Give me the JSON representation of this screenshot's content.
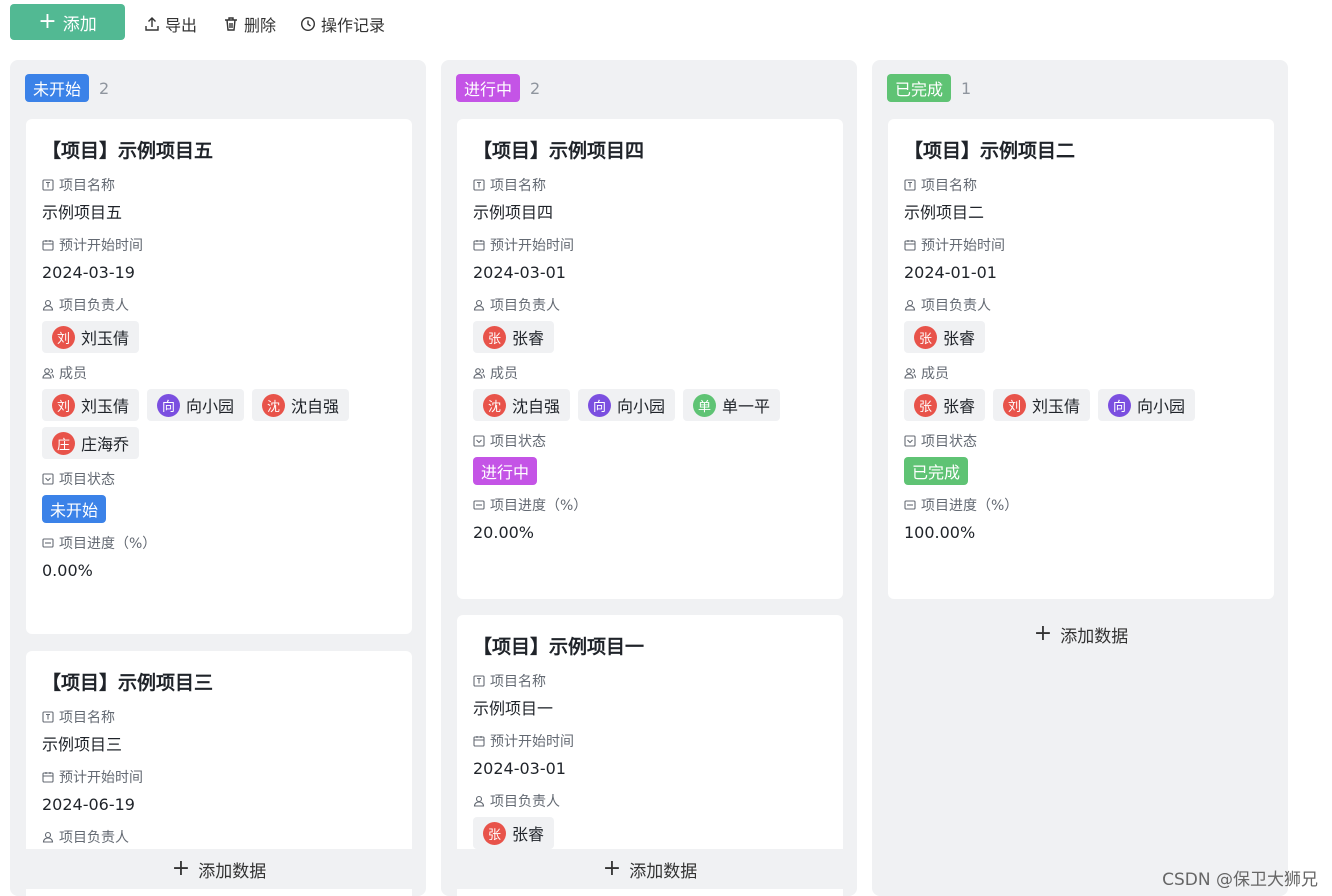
{
  "toolbar": {
    "add_label": "添加",
    "export_label": "导出",
    "delete_label": "删除",
    "history_label": "操作记录"
  },
  "field_labels": {
    "name": "项目名称",
    "start": "预计开始时间",
    "owner": "项目负责人",
    "members": "成员",
    "status": "项目状态",
    "progress": "项目进度（%）"
  },
  "add_data_label": "添加数据",
  "colors": {
    "not_started": "#3b82e8",
    "in_progress": "#c454e6",
    "done": "#5fc374",
    "add_button": "#52b993"
  },
  "columns": [
    {
      "status": "未开始",
      "count": "2",
      "cards": [
        {
          "title": "【项目】示例项目五",
          "name": "示例项目五",
          "start": "2024-03-19",
          "owner": [
            {
              "name": "刘玉倩",
              "initial": "刘",
              "color": "#e8534a"
            }
          ],
          "members": [
            {
              "name": "刘玉倩",
              "initial": "刘",
              "color": "#e8534a"
            },
            {
              "name": "向小园",
              "initial": "向",
              "color": "#7b4fe0"
            },
            {
              "name": "沈自强",
              "initial": "沈",
              "color": "#e8534a"
            },
            {
              "name": "庄海乔",
              "initial": "庄",
              "color": "#e8534a"
            }
          ],
          "status": "未开始",
          "progress": "0.00%"
        },
        {
          "title": "【项目】示例项目三",
          "name": "示例项目三",
          "start": "2024-06-19",
          "owner_partial": "项目负责人"
        }
      ]
    },
    {
      "status": "进行中",
      "count": "2",
      "cards": [
        {
          "title": "【项目】示例项目四",
          "name": "示例项目四",
          "start": "2024-03-01",
          "owner": [
            {
              "name": "张睿",
              "initial": "张",
              "color": "#e8534a"
            }
          ],
          "members": [
            {
              "name": "沈自强",
              "initial": "沈",
              "color": "#e8534a"
            },
            {
              "name": "向小园",
              "initial": "向",
              "color": "#7b4fe0"
            },
            {
              "name": "单一平",
              "initial": "单",
              "color": "#5fc374"
            }
          ],
          "status": "进行中",
          "progress": "20.00%"
        },
        {
          "title": "【项目】示例项目一",
          "name": "示例项目一",
          "start": "2024-03-01",
          "owner": [
            {
              "name": "张睿",
              "initial": "张",
              "color": "#e8534a"
            }
          ]
        }
      ]
    },
    {
      "status": "已完成",
      "count": "1",
      "cards": [
        {
          "title": "【项目】示例项目二",
          "name": "示例项目二",
          "start": "2024-01-01",
          "owner": [
            {
              "name": "张睿",
              "initial": "张",
              "color": "#e8534a"
            }
          ],
          "members": [
            {
              "name": "张睿",
              "initial": "张",
              "color": "#e8534a"
            },
            {
              "name": "刘玉倩",
              "initial": "刘",
              "color": "#e8534a"
            },
            {
              "name": "向小园",
              "initial": "向",
              "color": "#7b4fe0"
            }
          ],
          "status": "已完成",
          "progress": "100.00%"
        }
      ]
    }
  ],
  "watermark": "CSDN @保卫大狮兄"
}
